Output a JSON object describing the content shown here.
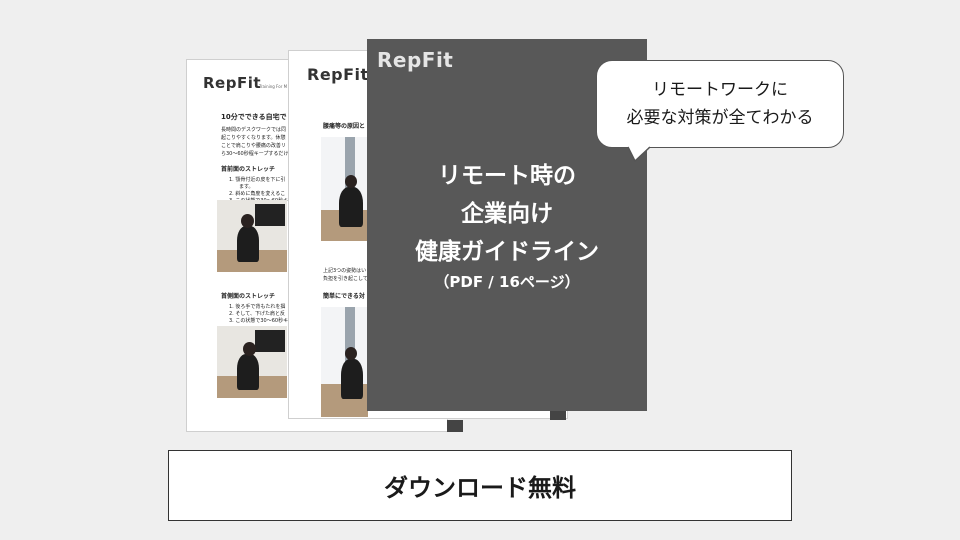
{
  "back_page": {
    "logo": "RepFit",
    "tagline": "Training For M",
    "heading": "10分でできる自宅で",
    "para": [
      "長時間のデスクワークでは同",
      "起こりやすくなります。休憩",
      "ことで肩こりや腰痛の改善リ",
      "ら30〜60秒程キープするだけ"
    ],
    "section1": "首前面のストレッチ",
    "section1_items": [
      "1. 顎骨付近の皮を下に引",
      "ます。",
      "2. 斜めに角度を変えるこ",
      "3. この状態で30〜60秒キ"
    ],
    "section2": "首側面のストレッチ",
    "section2_items": [
      "1. 後ろ手で背もたれを掴",
      "2. そして、下げた肩と反",
      "3. この状態で30〜60秒キ"
    ]
  },
  "middle_page": {
    "logo": "RepFit",
    "heading1": "腰痛等の原因と",
    "para": [
      "上記3つの姿勢はい",
      "負担を引き起こして"
    ],
    "heading2": "簡単にできる対"
  },
  "cover": {
    "logo": "RepFit",
    "title_lines": [
      "リモート時の",
      "企業向け",
      "健康ガイドライン"
    ],
    "subtitle": "（PDF / 16ページ）"
  },
  "bubble": {
    "line1": "リモートワークに",
    "line2": "必要な対策が全てわかる"
  },
  "download_button": "ダウンロード無料",
  "colors": {
    "background": "#efefef",
    "cover": "#585858",
    "border": "#333333"
  }
}
